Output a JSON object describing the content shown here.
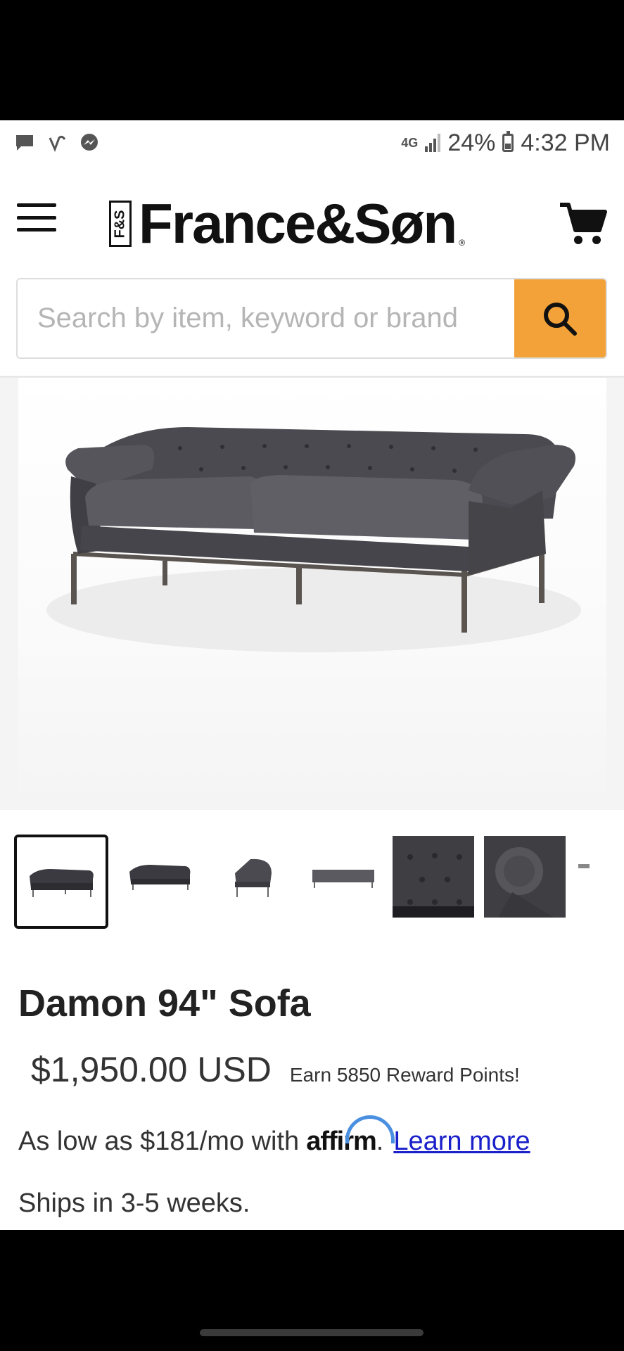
{
  "status_bar": {
    "network": "4G",
    "battery": "24%",
    "time": "4:32 PM",
    "left_icons": [
      "chat-icon",
      "swype-icon",
      "messenger-icon"
    ]
  },
  "header": {
    "logo_badge": "F&S",
    "logo_text": "France&Søn",
    "logo_mark": "®"
  },
  "search": {
    "placeholder": "Search by item, keyword or brand"
  },
  "product": {
    "title": "Damon 94\" Sofa",
    "price": "$1,950.00 USD",
    "reward": "Earn 5850 Reward Points!",
    "financing_prefix": "As low as $181/mo with",
    "affirm": "affirm",
    "financing_period": ".",
    "learn_more": "Learn more",
    "shipping": "Ships in 3-5 weeks."
  },
  "thumbnails": [
    {
      "view": "front",
      "selected": true
    },
    {
      "view": "front"
    },
    {
      "view": "side"
    },
    {
      "view": "back"
    },
    {
      "view": "tufting-detail"
    },
    {
      "view": "arm-detail"
    },
    {
      "view": "more"
    }
  ],
  "colors": {
    "search_button": "#f2a238",
    "affirm_arc": "#4a8fe0",
    "link": "#1a20c9",
    "upholstery": "#4a4a50"
  }
}
